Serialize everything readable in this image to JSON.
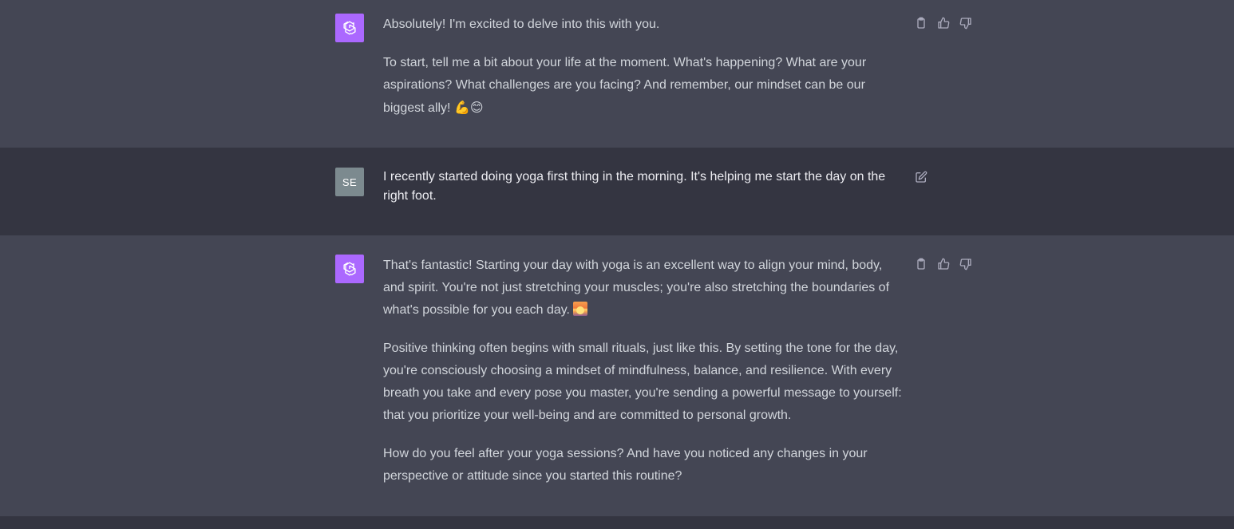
{
  "messages": [
    {
      "role": "assistant",
      "paragraphs": [
        "Absolutely! I'm excited to delve into this with you.",
        "To start, tell me a bit about your life at the moment. What's happening? What are your aspirations? What challenges are you facing? And remember, our mindset can be our biggest ally!"
      ],
      "emoji_tail": "💪😊",
      "actions": [
        "copy-icon",
        "thumbs-up-icon",
        "thumbs-down-icon"
      ]
    },
    {
      "role": "user",
      "avatar_initials": "SE",
      "text": "I recently started doing yoga first thing in the morning. It's helping me start the day on the right foot.",
      "actions": [
        "edit-icon"
      ]
    },
    {
      "role": "assistant",
      "paragraphs": [
        "That's fantastic! Starting your day with yoga is an excellent way to align your mind, body, and spirit. You're not just stretching your muscles; you're also stretching the boundaries of what's possible for you each day.",
        "Positive thinking often begins with small rituals, just like this. By setting the tone for the day, you're consciously choosing a mindset of mindfulness, balance, and resilience. With every breath you take and every pose you master, you're sending a powerful message to yourself: that you prioritize your well-being and are committed to personal growth.",
        "How do you feel after your yoga sessions? And have you noticed any changes in your perspective or attitude since you started this routine?"
      ],
      "emoji_tail": "sunrise-emoji",
      "actions": [
        "copy-icon",
        "thumbs-up-icon",
        "thumbs-down-icon"
      ]
    }
  ],
  "colors": {
    "assistant_bg": "#444654",
    "user_bg": "#343541",
    "bot_avatar": "#ab68ff",
    "user_avatar": "#7c8a8f"
  }
}
